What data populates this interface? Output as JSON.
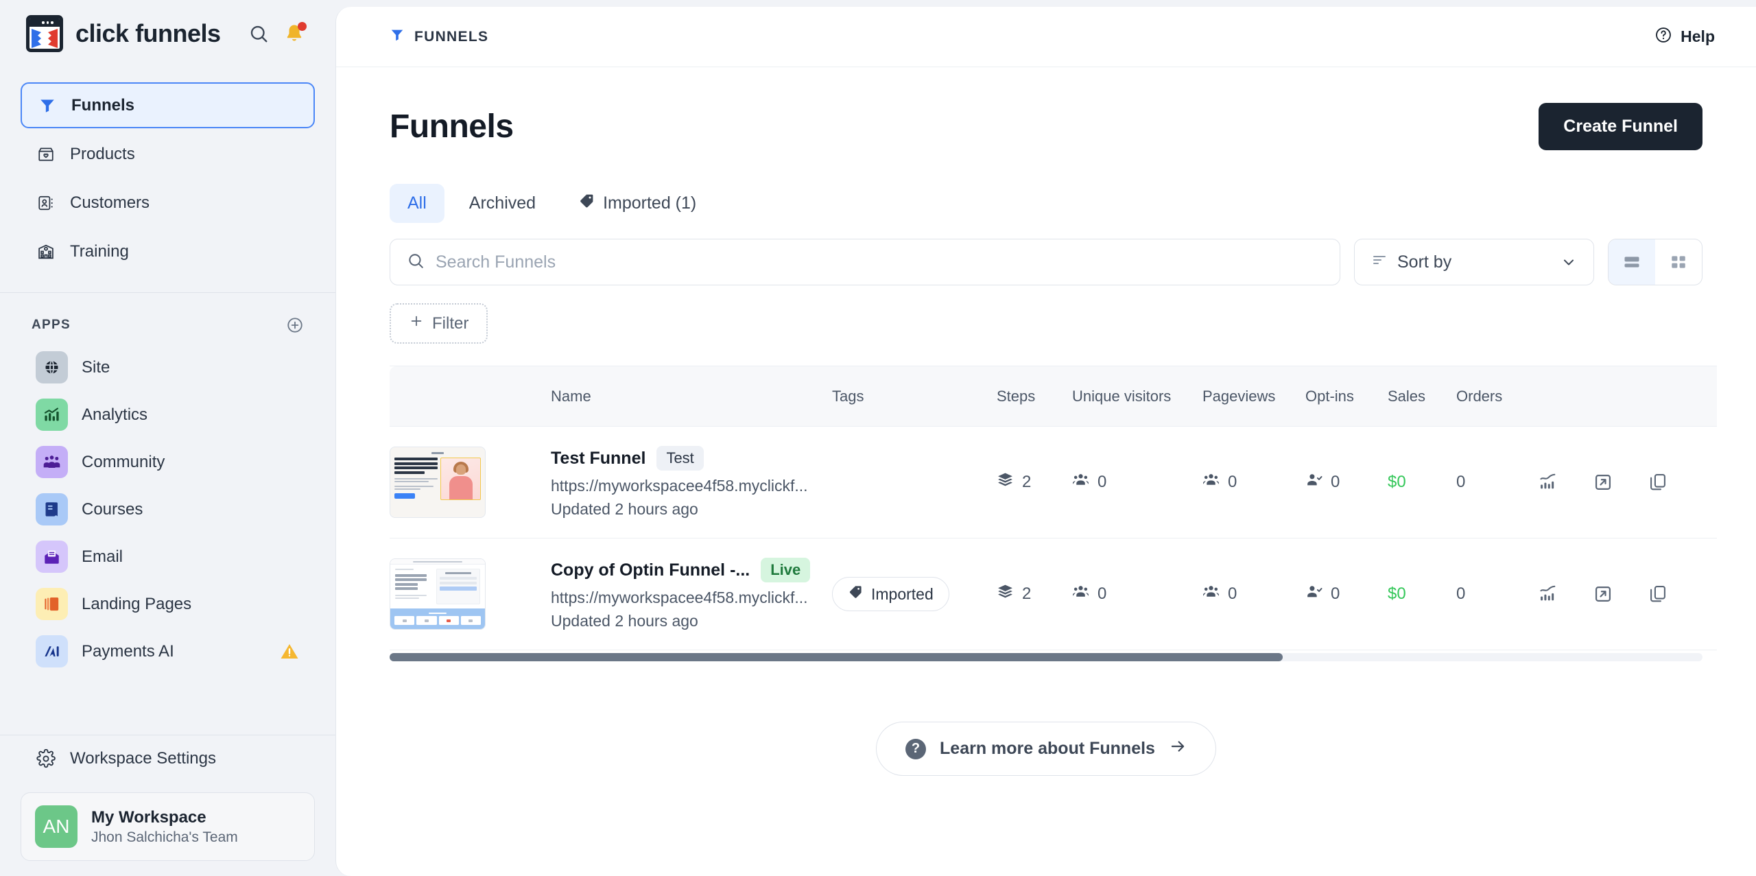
{
  "brand": {
    "name": "click funnels",
    "logo_icon": "clickfunnels-logo-icon",
    "search_icon": "search-icon",
    "notifications_icon": "bell-icon"
  },
  "sidebar": {
    "nav": [
      {
        "label": "Funnels",
        "icon": "funnel-icon",
        "active": true
      },
      {
        "label": "Products",
        "icon": "box-heart-icon",
        "active": false
      },
      {
        "label": "Customers",
        "icon": "contact-card-icon",
        "active": false
      },
      {
        "label": "Training",
        "icon": "school-icon",
        "active": false
      }
    ],
    "apps_header": {
      "title": "APPS",
      "add_icon": "plus-circle-icon"
    },
    "apps": [
      {
        "label": "Site",
        "icon": "globe-icon",
        "bg": "#c3ccd6",
        "fg": "#1b2430",
        "warn": false
      },
      {
        "label": "Analytics",
        "icon": "chart-icon",
        "bg": "#7fd9a4",
        "fg": "#14532d",
        "warn": false
      },
      {
        "label": "Community",
        "icon": "people-icon",
        "bg": "#c4aef7",
        "fg": "#4c1d95",
        "warn": false
      },
      {
        "label": "Courses",
        "icon": "book-icon",
        "bg": "#a9c9f7",
        "fg": "#1e3a8a",
        "warn": false
      },
      {
        "label": "Email",
        "icon": "envelope-icon",
        "bg": "#d5c6fb",
        "fg": "#5b21b6",
        "warn": false
      },
      {
        "label": "Landing Pages",
        "icon": "pages-icon",
        "bg": "#fdeeb4",
        "fg": "#e2622a",
        "warn": false
      },
      {
        "label": "Payments AI",
        "icon": "payments-ai-icon",
        "bg": "#cfe0fb",
        "fg": "#16348c",
        "warn": true
      }
    ],
    "workspace_settings": {
      "label": "Workspace Settings",
      "icon": "gear-icon"
    },
    "workspace": {
      "initials": "AN",
      "name": "My Workspace",
      "team": "Jhon Salchicha's Team",
      "avatar_color": "#6cc788"
    }
  },
  "topbar": {
    "breadcrumb": "FUNNELS",
    "breadcrumb_icon": "funnel-icon",
    "help_label": "Help",
    "help_icon": "question-circle-icon"
  },
  "page": {
    "title": "Funnels",
    "create_button": "Create Funnel"
  },
  "tabs": [
    {
      "label": "All",
      "icon": null,
      "active": true
    },
    {
      "label": "Archived",
      "icon": null,
      "active": false
    },
    {
      "label": "Imported (1)",
      "icon": "tag-icon",
      "active": false
    }
  ],
  "toolbar": {
    "search_placeholder": "Search Funnels",
    "search_value": "",
    "search_icon": "search-icon",
    "sort_label": "Sort by",
    "sort_icon": "sort-icon",
    "sort_chevron": "chevron-down-icon",
    "view_list_icon": "list-view-icon",
    "view_grid_icon": "grid-view-icon",
    "view_active": "list",
    "filter_label": "Filter",
    "filter_icon": "plus-icon"
  },
  "table": {
    "columns": [
      "",
      "Name",
      "Tags",
      "Steps",
      "Unique visitors",
      "Pageviews",
      "Opt-ins",
      "Sales",
      "Orders",
      ""
    ],
    "rows": [
      {
        "thumbnail": "funnel-thumbnail-model-landing-page",
        "name": "Test Funnel",
        "status_chip": "Test",
        "status_type": "neutral",
        "url": "https://myworkspacee4f58.myclickf...",
        "updated": "Updated 2 hours ago",
        "tag": null,
        "steps": "2",
        "unique_visitors": "0",
        "pageviews": "0",
        "optins": "0",
        "sales": "$0",
        "orders": "0"
      },
      {
        "thumbnail": "funnel-thumbnail-optin-page",
        "name": "Copy of Optin Funnel -...",
        "status_chip": "Live",
        "status_type": "live",
        "url": "https://myworkspacee4f58.myclickf...",
        "updated": "Updated 2 hours ago",
        "tag": "Imported",
        "tag_icon": "tag-icon",
        "steps": "2",
        "unique_visitors": "0",
        "pageviews": "0",
        "optins": "0",
        "sales": "$0",
        "orders": "0"
      }
    ],
    "row_actions": [
      {
        "icon": "stats-icon",
        "name": "view-stats"
      },
      {
        "icon": "external-link-icon",
        "name": "open-funnel"
      },
      {
        "icon": "duplicate-icon",
        "name": "duplicate-funnel"
      }
    ],
    "metric_icons": {
      "steps": "layers-icon",
      "unique_visitors": "users-icon",
      "pageviews": "users-icon",
      "optins": "user-check-icon"
    }
  },
  "footer": {
    "learn_more": "Learn more about Funnels",
    "learn_icon": "question-circle-filled-icon",
    "arrow_icon": "arrow-right-icon"
  },
  "colors": {
    "accent": "#2f6fe8",
    "accent_soft": "#eaf2fe",
    "dark": "#1b2430",
    "money_green": "#34c759",
    "live_green": "#1f7a3d",
    "warn_amber": "#f5b731"
  }
}
